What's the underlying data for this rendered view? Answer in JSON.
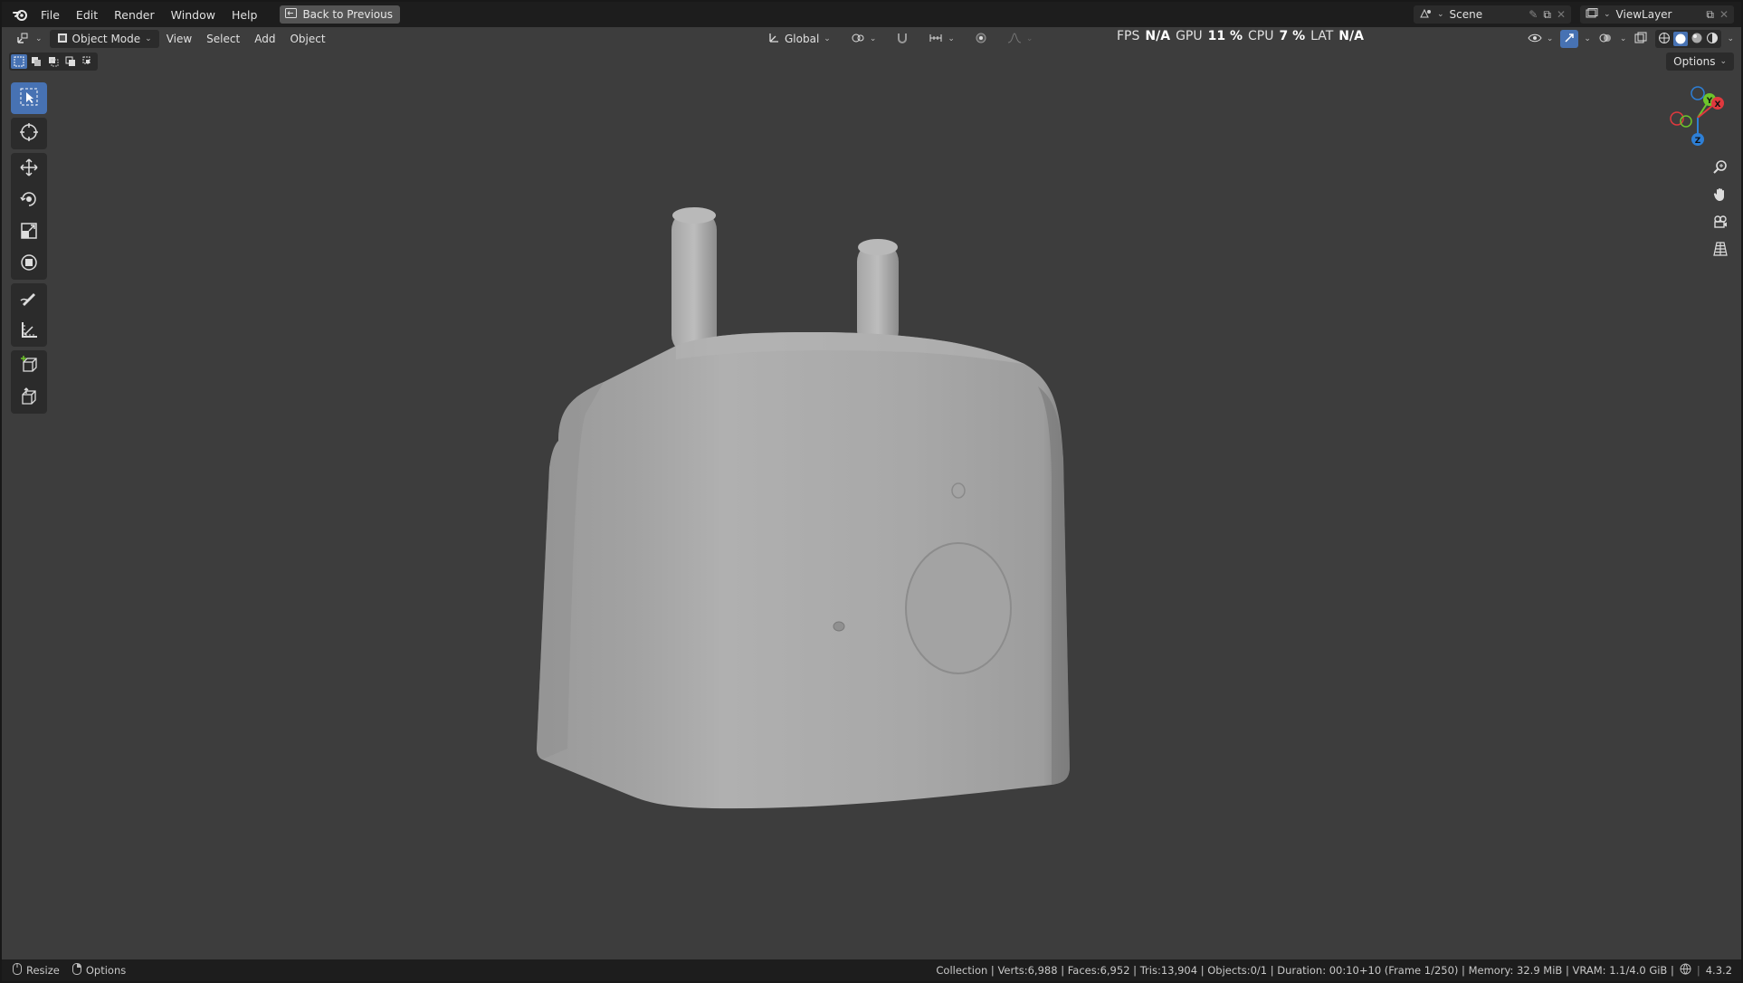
{
  "menubar": {
    "items": [
      "File",
      "Edit",
      "Render",
      "Window",
      "Help"
    ],
    "back_button": "Back to Previous",
    "scene": "Scene",
    "view_layer": "ViewLayer"
  },
  "header": {
    "mode": "Object Mode",
    "menus": [
      "View",
      "Select",
      "Add",
      "Object"
    ],
    "transform_orientation": "Global",
    "options": "Options"
  },
  "stats": {
    "fps_label": "FPS",
    "fps_value": "N/A",
    "gpu_label": "GPU",
    "gpu_value": "11 %",
    "cpu_label": "CPU",
    "cpu_value": "7 %",
    "lat_label": "LAT",
    "lat_value": "N/A"
  },
  "gizmo": {
    "x": "X",
    "y": "Y",
    "z": "Z",
    "colors": {
      "x": "#e0393e",
      "y": "#6ec52b",
      "z": "#2d7fd6"
    }
  },
  "statusbar": {
    "resize": "Resize",
    "options": "Options",
    "info": "Collection | Verts:6,988 | Faces:6,952 | Tris:13,904 | Objects:0/1 | Duration: 00:10+10 (Frame 1/250) | Memory: 32.9 MiB | VRAM: 1.1/4.0 GiB |",
    "version": "4.3.2"
  },
  "colors": {
    "accent": "#4772b3",
    "viewport_bg": "#3d3d3d",
    "bar_bg": "#1d1d1d"
  }
}
